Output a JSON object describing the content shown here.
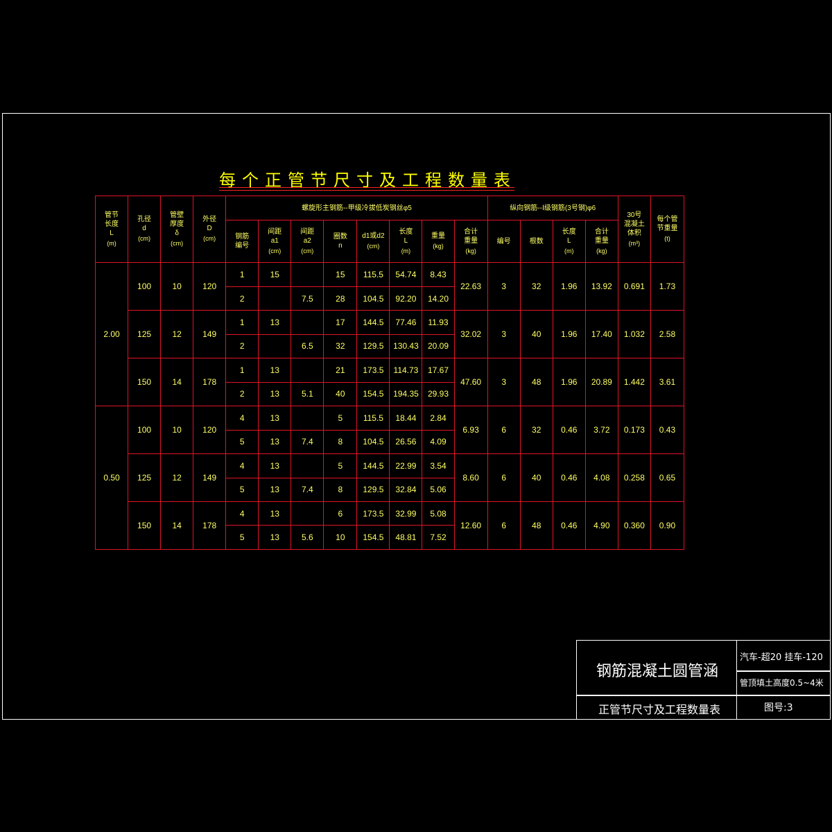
{
  "title": "每个正管节尺寸及工程数量表",
  "headers": {
    "length": [
      "管节",
      "长度",
      "L",
      "(m)"
    ],
    "bore": [
      "孔径",
      "d",
      "(cm)"
    ],
    "wall": [
      "管壁",
      "厚度",
      "δ",
      "(cm)"
    ],
    "outer": [
      "外径",
      "D",
      "(cm)"
    ],
    "spiral_group": "螺旋形主钢筋--甲级冷拔低炭钢丝φ5",
    "spiral_no": [
      "钢筋",
      "编号"
    ],
    "spacing1": [
      "间距",
      "a1",
      "(cm)"
    ],
    "spacing2": [
      "间距",
      "a2",
      "(cm)"
    ],
    "turns": [
      "圈数",
      "n"
    ],
    "d1d2": [
      "d1或d2",
      "(cm)"
    ],
    "length_L": [
      "长度",
      "L",
      "(m)"
    ],
    "weight": [
      "重量",
      "(kg)"
    ],
    "total_weight": [
      "合计",
      "重量",
      "(kg)"
    ],
    "long_group": "纵向钢筋--Ⅰ级钢筋(3号钢)φ6",
    "long_no": "编号",
    "long_count": "根数",
    "long_len": [
      "长度",
      "L",
      "(m)"
    ],
    "long_total": [
      "合计",
      "重量",
      "(kg)"
    ],
    "concrete": [
      "30号",
      "混凝土",
      "体积",
      "(m³)"
    ],
    "each_weight": [
      "每个管",
      "节重量",
      "(t)"
    ]
  },
  "groups": [
    {
      "L": "2.00",
      "sizes": [
        {
          "d": "100",
          "t": "10",
          "D": "120",
          "total": "22.63",
          "lno": "3",
          "lcount": "32",
          "llen": "1.96",
          "lsum": "13.92",
          "vol": "0.691",
          "wt": "1.73",
          "rows": [
            {
              "no": "1",
              "a1": "15",
              "a2": "",
              "n": "15",
              "dd": "115.5",
              "len": "54.74",
              "w": "8.43"
            },
            {
              "no": "2",
              "a1": "",
              "a2": "7.5",
              "n": "28",
              "dd": "104.5",
              "len": "92.20",
              "w": "14.20"
            }
          ]
        },
        {
          "d": "125",
          "t": "12",
          "D": "149",
          "total": "32.02",
          "lno": "3",
          "lcount": "40",
          "llen": "1.96",
          "lsum": "17.40",
          "vol": "1.032",
          "wt": "2.58",
          "rows": [
            {
              "no": "1",
              "a1": "13",
              "a2": "",
              "n": "17",
              "dd": "144.5",
              "len": "77.46",
              "w": "11.93"
            },
            {
              "no": "2",
              "a1": "",
              "a2": "6.5",
              "n": "32",
              "dd": "129.5",
              "len": "130.43",
              "w": "20.09"
            }
          ]
        },
        {
          "d": "150",
          "t": "14",
          "D": "178",
          "total": "47.60",
          "lno": "3",
          "lcount": "48",
          "llen": "1.96",
          "lsum": "20.89",
          "vol": "1.442",
          "wt": "3.61",
          "rows": [
            {
              "no": "1",
              "a1": "13",
              "a2": "",
              "n": "21",
              "dd": "173.5",
              "len": "114.73",
              "w": "17.67"
            },
            {
              "no": "2",
              "a1": "13",
              "a2": "5.1",
              "n": "40",
              "dd": "154.5",
              "len": "194.35",
              "w": "29.93"
            }
          ]
        }
      ]
    },
    {
      "L": "0.50",
      "sizes": [
        {
          "d": "100",
          "t": "10",
          "D": "120",
          "total": "6.93",
          "lno": "6",
          "lcount": "32",
          "llen": "0.46",
          "lsum": "3.72",
          "vol": "0.173",
          "wt": "0.43",
          "rows": [
            {
              "no": "4",
              "a1": "13",
              "a2": "",
              "n": "5",
              "dd": "115.5",
              "len": "18.44",
              "w": "2.84"
            },
            {
              "no": "5",
              "a1": "13",
              "a2": "7.4",
              "n": "8",
              "dd": "104.5",
              "len": "26.56",
              "w": "4.09"
            }
          ]
        },
        {
          "d": "125",
          "t": "12",
          "D": "149",
          "total": "8.60",
          "lno": "6",
          "lcount": "40",
          "llen": "0.46",
          "lsum": "4.08",
          "vol": "0.258",
          "wt": "0.65",
          "rows": [
            {
              "no": "4",
              "a1": "13",
              "a2": "",
              "n": "5",
              "dd": "144.5",
              "len": "22.99",
              "w": "3.54"
            },
            {
              "no": "5",
              "a1": "13",
              "a2": "7.4",
              "n": "8",
              "dd": "129.5",
              "len": "32.84",
              "w": "5.06"
            }
          ]
        },
        {
          "d": "150",
          "t": "14",
          "D": "178",
          "total": "12.60",
          "lno": "6",
          "lcount": "48",
          "llen": "0.46",
          "lsum": "4.90",
          "vol": "0.360",
          "wt": "0.90",
          "rows": [
            {
              "no": "4",
              "a1": "13",
              "a2": "",
              "n": "6",
              "dd": "173.5",
              "len": "32.99",
              "w": "5.08"
            },
            {
              "no": "5",
              "a1": "13",
              "a2": "5.6",
              "n": "10",
              "dd": "154.5",
              "len": "48.81",
              "w": "7.52"
            }
          ]
        }
      ]
    }
  ],
  "titleblock": {
    "project": "钢筋混凝土圆管涵",
    "load": "汽车-超20  挂车-120",
    "fill": "管顶填土高度0.5~4米",
    "drawing": "正管节尺寸及工程数量表",
    "sheet_no": "图号:3"
  },
  "colors": {
    "grid": "#e0142a",
    "text": "#ffff66",
    "frame": "#ffffff",
    "background": "#000000"
  }
}
